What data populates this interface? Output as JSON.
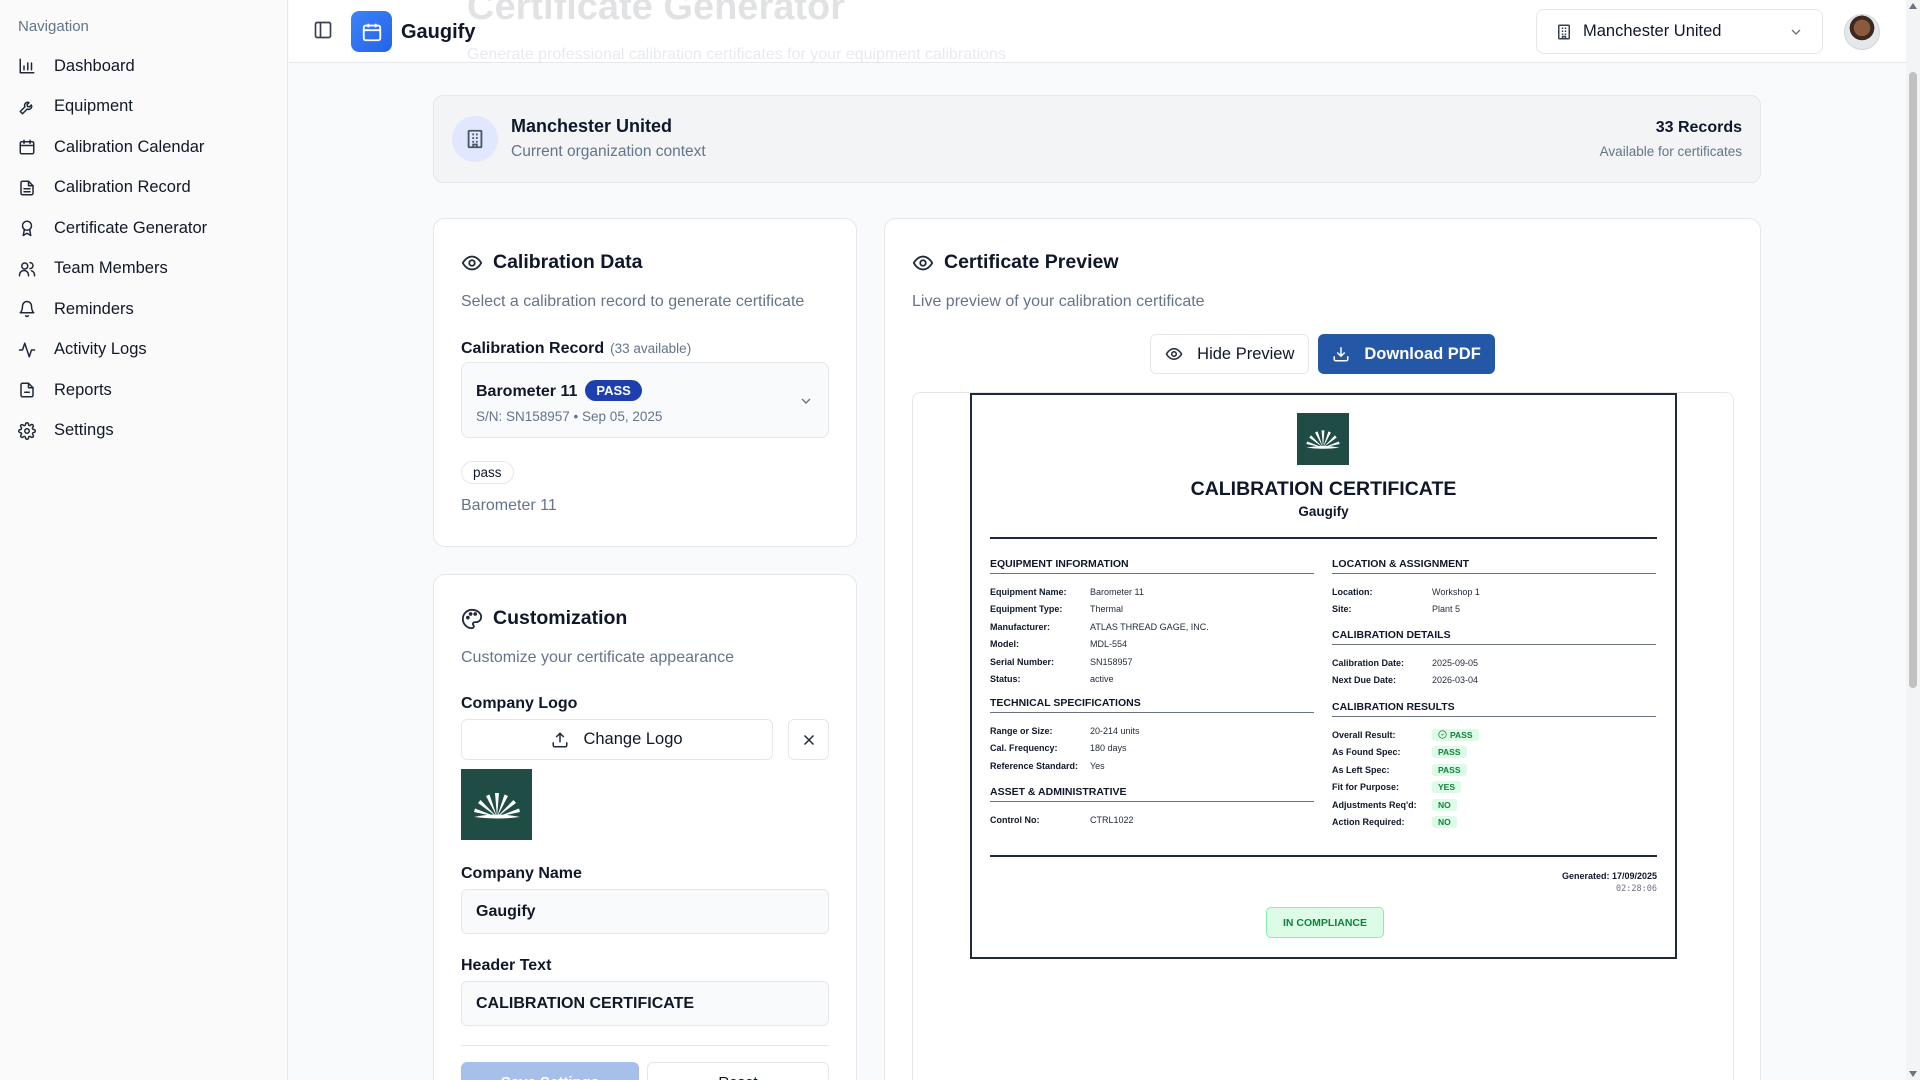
{
  "sidebar": {
    "heading": "Navigation",
    "items": [
      {
        "label": "Dashboard",
        "icon": "bar-chart-icon"
      },
      {
        "label": "Equipment",
        "icon": "wrench-icon"
      },
      {
        "label": "Calibration Calendar",
        "icon": "calendar-icon"
      },
      {
        "label": "Calibration Record",
        "icon": "file-text-icon"
      },
      {
        "label": "Certificate Generator",
        "icon": "award-icon"
      },
      {
        "label": "Team Members",
        "icon": "users-icon"
      },
      {
        "label": "Reminders",
        "icon": "bell-icon"
      },
      {
        "label": "Activity Logs",
        "icon": "activity-icon"
      },
      {
        "label": "Reports",
        "icon": "report-icon"
      },
      {
        "label": "Settings",
        "icon": "gear-icon"
      }
    ]
  },
  "header": {
    "app_name": "Gaugify",
    "ghost_title": "Certificate Generator",
    "ghost_subtitle": "Generate professional calibration certificates for your equipment calibrations",
    "org_selector": "Manchester United"
  },
  "org_context": {
    "name": "Manchester United",
    "subtitle": "Current organization context",
    "records": "33 Records",
    "records_caption": "Available for certificates"
  },
  "calibration_data": {
    "title": "Calibration Data",
    "description": "Select a calibration record to generate certificate",
    "field_label": "Calibration Record",
    "field_count": "(33 available)",
    "selected_name": "Barometer 11",
    "selected_badge": "PASS",
    "selected_sub": "S/N: SN158957 • Sep 05, 2025",
    "status_pill": "pass",
    "equipment_name": "Barometer 11"
  },
  "customization": {
    "title": "Customization",
    "description": "Customize your certificate appearance",
    "logo_label": "Company Logo",
    "change_logo": "Change Logo",
    "company_name_label": "Company Name",
    "company_name_value": "Gaugify",
    "header_text_label": "Header Text",
    "header_text_value": "CALIBRATION CERTIFICATE",
    "save_label": "Save Settings",
    "reset_label": "Reset"
  },
  "preview": {
    "title": "Certificate Preview",
    "description": "Live preview of your calibration certificate",
    "hide_label": "Hide Preview",
    "download_label": "Download PDF"
  },
  "certificate": {
    "title": "CALIBRATION CERTIFICATE",
    "company": "Gaugify",
    "equipment_info": {
      "heading": "EQUIPMENT INFORMATION",
      "rows": [
        {
          "k": "Equipment Name:",
          "v": "Barometer 11"
        },
        {
          "k": "Equipment Type:",
          "v": "Thermal"
        },
        {
          "k": "Manufacturer:",
          "v": "ATLAS THREAD GAGE, INC."
        },
        {
          "k": "Model:",
          "v": "MDL-554"
        },
        {
          "k": "Serial Number:",
          "v": "SN158957"
        },
        {
          "k": "Status:",
          "v": "active"
        }
      ]
    },
    "technical_specs": {
      "heading": "TECHNICAL SPECIFICATIONS",
      "rows": [
        {
          "k": "Range or Size:",
          "v": "20-214 units"
        },
        {
          "k": "Cal. Frequency:",
          "v": "180 days"
        },
        {
          "k": "Reference Standard:",
          "v": "Yes"
        }
      ]
    },
    "asset_admin": {
      "heading": "ASSET & ADMINISTRATIVE",
      "rows": [
        {
          "k": "Control No:",
          "v": "CTRL1022"
        }
      ]
    },
    "location": {
      "heading": "LOCATION & ASSIGNMENT",
      "rows": [
        {
          "k": "Location:",
          "v": "Workshop 1"
        },
        {
          "k": "Site:",
          "v": "Plant 5"
        }
      ]
    },
    "calibration_details": {
      "heading": "CALIBRATION DETAILS",
      "rows": [
        {
          "k": "Calibration Date:",
          "v": "2025-09-05"
        },
        {
          "k": "Next Due Date:",
          "v": "2026-03-04"
        }
      ]
    },
    "calibration_results": {
      "heading": "CALIBRATION RESULTS",
      "rows": [
        {
          "k": "Overall Result:",
          "v": "PASS"
        },
        {
          "k": "As Found Spec:",
          "v": "PASS"
        },
        {
          "k": "As Left Spec:",
          "v": "PASS"
        },
        {
          "k": "Fit for Purpose:",
          "v": "YES"
        },
        {
          "k": "Adjustments Req'd:",
          "v": "NO"
        },
        {
          "k": "Action Required:",
          "v": "NO"
        }
      ]
    },
    "generated": "Generated: 17/09/2025",
    "generated_time": "02:28:06",
    "compliance": "IN COMPLIANCE"
  },
  "colors": {
    "primary": "#2557a7",
    "pass_badge": "#1e40af",
    "logo_bg": "#1f4d45",
    "success": "#15803d"
  }
}
